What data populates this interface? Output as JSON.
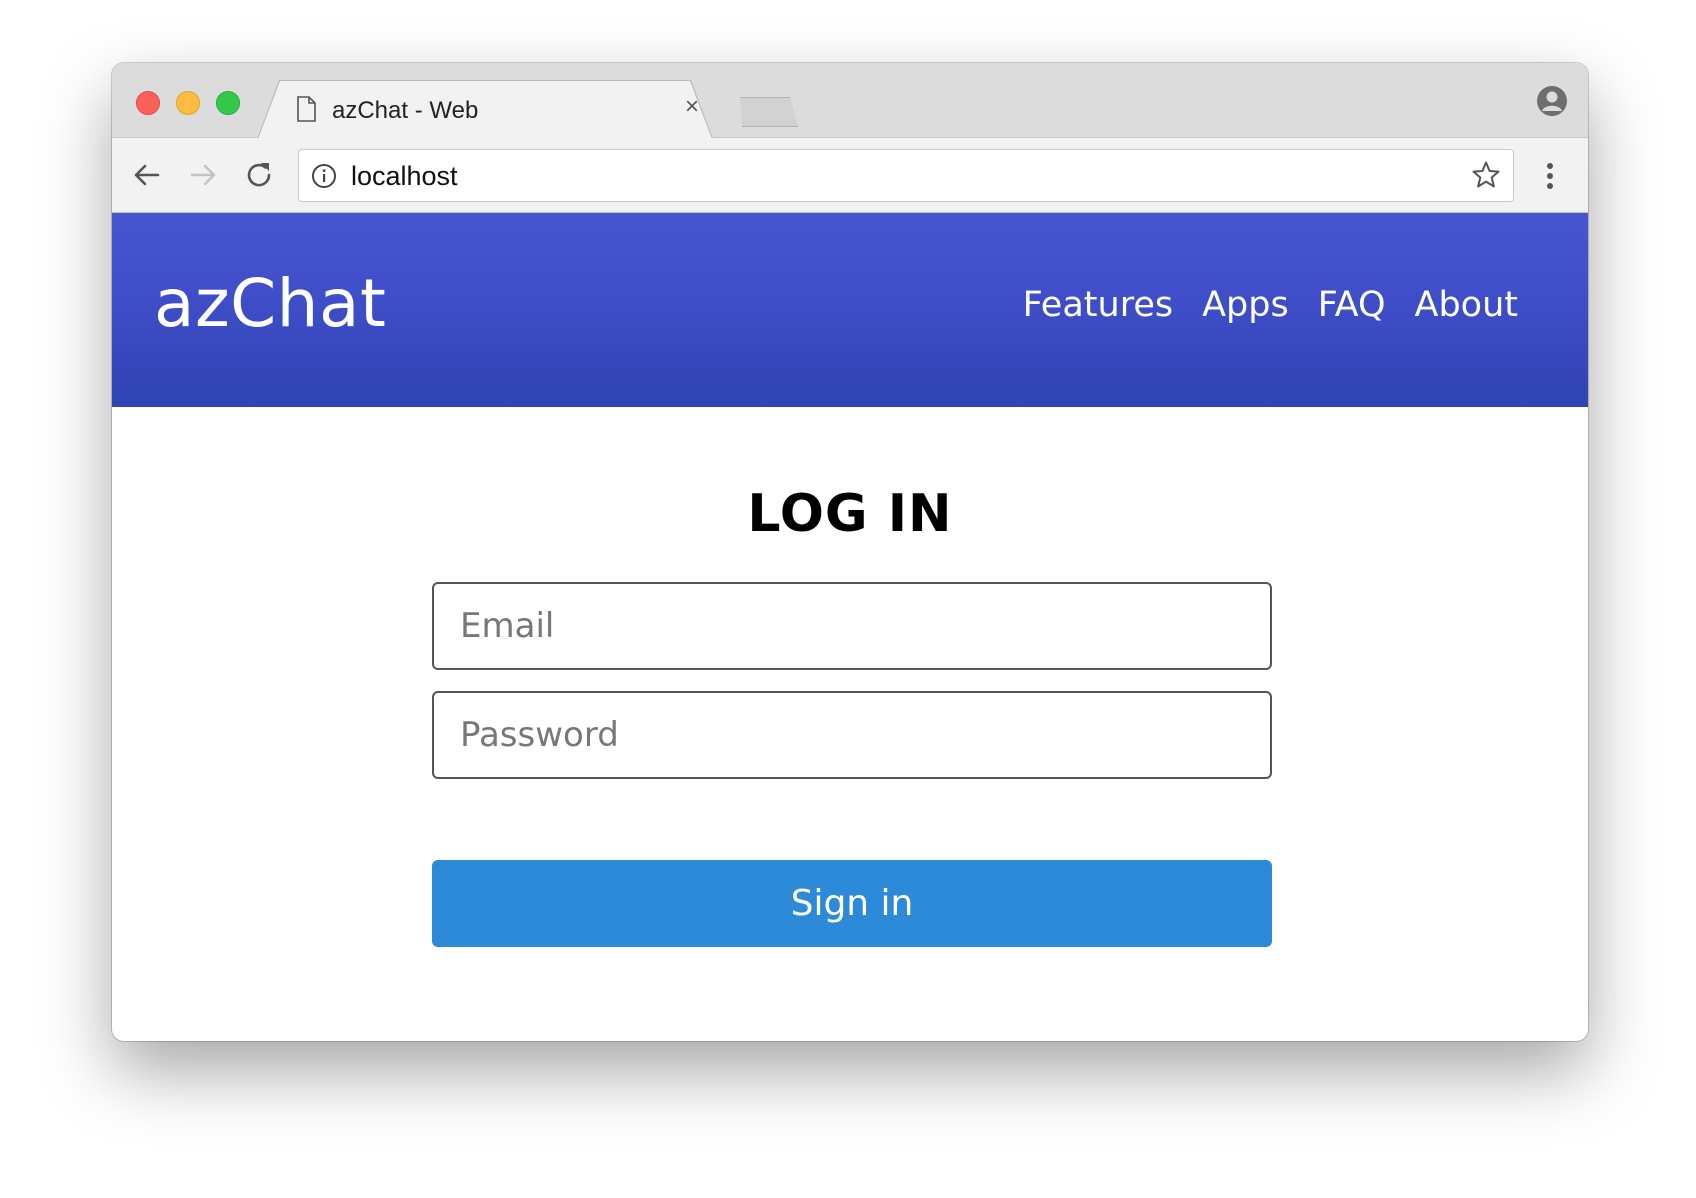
{
  "browser": {
    "tab_title": "azChat - Web",
    "tab_close": "×",
    "url": "localhost"
  },
  "header": {
    "brand": "azChat",
    "nav": [
      {
        "label": "Features"
      },
      {
        "label": "Apps"
      },
      {
        "label": "FAQ"
      },
      {
        "label": "About"
      }
    ]
  },
  "login": {
    "title": "LOG IN",
    "email_placeholder": "Email",
    "password_placeholder": "Password",
    "submit_label": "Sign in"
  },
  "colors": {
    "header_top": "#4755d1",
    "header_bottom": "#2f43b2",
    "button": "#2d8ad9"
  },
  "icons": [
    "document-icon",
    "close-icon",
    "new-tab-icon",
    "profile-icon",
    "back-icon",
    "forward-icon",
    "reload-icon",
    "info-icon",
    "star-icon",
    "menu-icon"
  ]
}
